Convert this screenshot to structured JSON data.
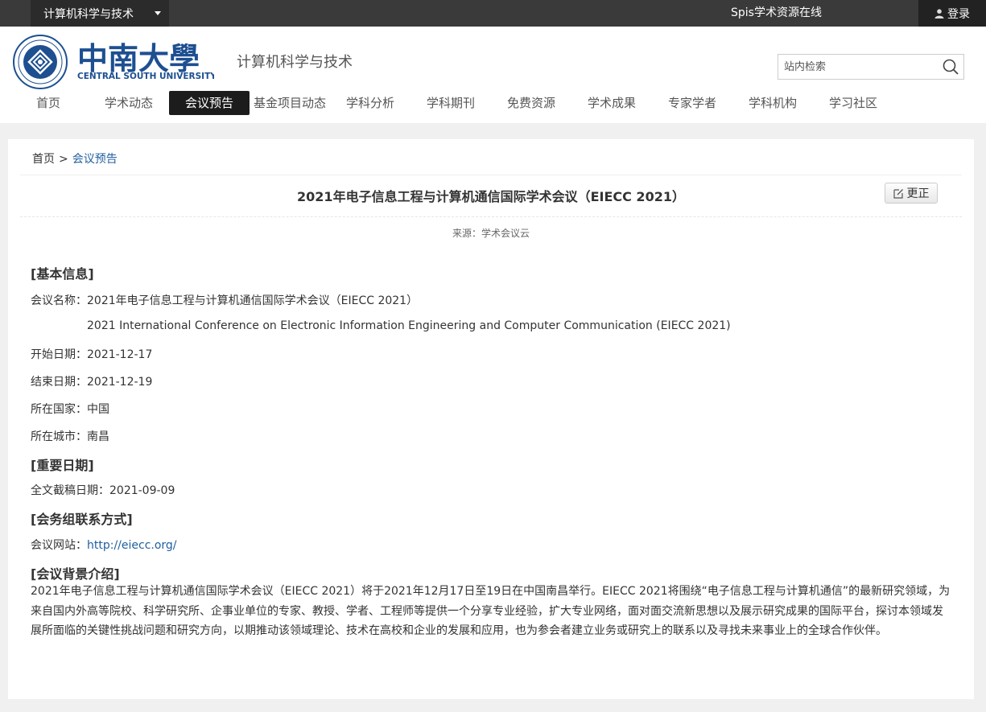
{
  "topbar": {
    "site_switch": "计算机科学与技术",
    "spis": "Spis学术资源在线",
    "login": "登录"
  },
  "header": {
    "logo_cn": "中南大學",
    "logo_en": "CENTRAL SOUTH UNIVERSITY",
    "site_name": "计算机科学与技术",
    "search_placeholder": "站内检索"
  },
  "nav": {
    "items": [
      "首页",
      "学术动态",
      "会议预告",
      "基金项目动态",
      "学科分析",
      "学科期刊",
      "免费资源",
      "学术成果",
      "专家学者",
      "学科机构",
      "学习社区"
    ],
    "active": "会议预告"
  },
  "breadcrumb": {
    "home": "首页",
    "sep": ">",
    "current": "会议预告"
  },
  "article": {
    "title": "2021年电子信息工程与计算机通信国际学术会议（EIECC 2021）",
    "fix_button": "更正",
    "source": "来源：学术会议云"
  },
  "basic": {
    "heading": "[基本信息]",
    "name_label": "会议名称：",
    "name_cn": "2021年电子信息工程与计算机通信国际学术会议（EIECC 2021）",
    "name_en": "2021 International Conference on Electronic Information Engineering and Computer Communication (EIECC 2021)",
    "start_label": "开始日期：",
    "start": "2021-12-17",
    "end_label": "结束日期：",
    "end": "2021-12-19",
    "country_label": "所在国家：",
    "country": "中国",
    "city_label": "所在城市：",
    "city": "南昌"
  },
  "dates": {
    "heading": "[重要日期]",
    "deadline_label": "全文截稿日期：",
    "deadline": "2021-09-09"
  },
  "contact": {
    "heading": "[会务组联系方式]",
    "site_label": "会议网站：",
    "site": "http://eiecc.org/"
  },
  "background": {
    "heading": "[会议背景介绍]",
    "text": "2021年电子信息工程与计算机通信国际学术会议（EIECC 2021）将于2021年12月17日至19日在中国南昌举行。EIECC 2021将围绕“电子信息工程与计算机通信”的最新研究领域，为来自国内外高等院校、科学研究所、企事业单位的专家、教授、学者、工程师等提供一个分享专业经验，扩大专业网络，面对面交流新思想以及展示研究成果的国际平台，探讨本领域发展所面临的关键性挑战问题和研究方向，以期推动该领域理论、技术在高校和企业的发展和应用，也为参会者建立业务或研究上的联系以及寻找未来事业上的全球合作伙伴。"
  }
}
